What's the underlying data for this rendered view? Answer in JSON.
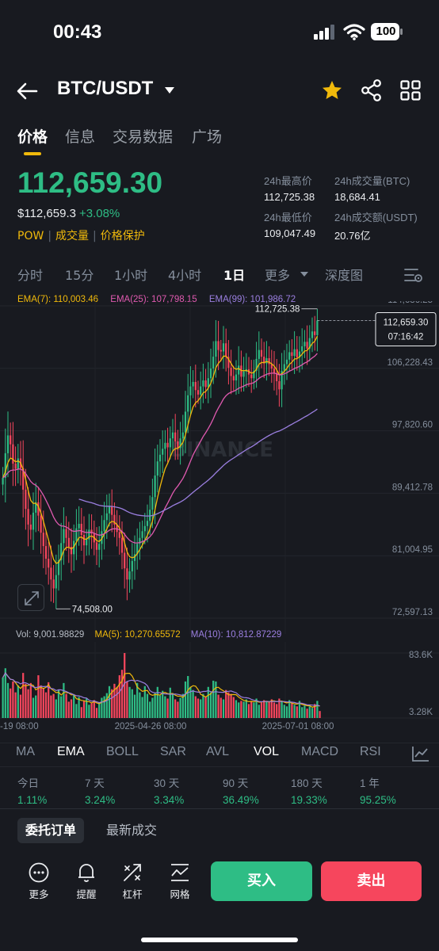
{
  "status_bar": {
    "time": "00:43",
    "battery": "100"
  },
  "header": {
    "pair": "BTC/USDT"
  },
  "main_tabs": [
    "价格",
    "信息",
    "交易数据",
    "广场"
  ],
  "price": {
    "last": "112,659.30",
    "fiat": "$112,659.3",
    "change": "+3.08%",
    "tags": [
      "POW",
      "成交量",
      "价格保护"
    ]
  },
  "stats": {
    "high_label": "24h最高价",
    "high": "112,725.38",
    "vol_btc_label": "24h成交量(BTC)",
    "vol_btc": "18,684.41",
    "low_label": "24h最低价",
    "low": "109,047.49",
    "vol_usdt_label": "24h成交额(USDT)",
    "vol_usdt": "20.76亿"
  },
  "intervals": [
    "分时",
    "15分",
    "1小时",
    "4小时",
    "1日",
    "更多",
    "深度图"
  ],
  "active_interval": "1日",
  "ema_legend": {
    "ema7": "EMA(7): 110,003.46",
    "ema25": "EMA(25): 107,798.15",
    "ema99": "EMA(99): 101,986.72"
  },
  "colors": {
    "up": "#2ebd85",
    "down": "#f6465d",
    "accent": "#f0b90b",
    "ema7": "#f0b90b",
    "ema25": "#e05ab0",
    "ema99": "#9b7fe0"
  },
  "chart_data": {
    "type": "candlestick",
    "y_ticks": [
      "114,636.25",
      "106,228.43",
      "97,820.60",
      "89,412.78",
      "81,004.95",
      "72,597.13"
    ],
    "ylim": [
      72597.13,
      114636.25
    ],
    "high_label": "112,725.38",
    "low_label": "74,508.00",
    "last_price_label": "112,659.30",
    "countdown": "07:16:42",
    "x_ticks": [
      "-19 08:00",
      "2025-04-26 08:00",
      "2025-07-01 08:00"
    ],
    "watermark": "BINANCE",
    "close": [
      91500,
      94800,
      97200,
      96000,
      93400,
      92700,
      94100,
      92800,
      89900,
      87300,
      85200,
      84500,
      86800,
      88200,
      86400,
      84100,
      82300,
      80600,
      79400,
      77800,
      76600,
      78400,
      80400,
      82700,
      84600,
      83400,
      82200,
      81200,
      83000,
      84700,
      85300,
      83800,
      82400,
      83200,
      84500,
      84000,
      82800,
      81800,
      82600,
      84300,
      85800,
      86700,
      87600,
      86500,
      85200,
      84200,
      83400,
      81400,
      79300,
      77800,
      78900,
      80300,
      81200,
      82600,
      83400,
      84300,
      85000,
      85700,
      87200,
      88900,
      91800,
      93700,
      94600,
      95400,
      96200,
      95600,
      96800,
      97600,
      96400,
      95500,
      96800,
      97600,
      100400,
      102600,
      103800,
      104400,
      103300,
      102700,
      103800,
      104600,
      103700,
      104900,
      106200,
      107800,
      109900,
      108700,
      108500,
      109600,
      107800,
      106300,
      105200,
      104600,
      105400,
      106600,
      105100,
      105800,
      106100,
      105400,
      104900,
      105900,
      107500,
      108700,
      107800,
      106900,
      107600,
      106800,
      106200,
      105600,
      104500,
      103400,
      105900,
      106800,
      107400,
      108400,
      107900,
      108800,
      107700,
      108500,
      109200,
      109800,
      108900,
      110300,
      111200,
      110700,
      112659
    ],
    "volume": {
      "y_ticks": [
        "83.6K",
        "3.28K"
      ],
      "vol": "Vol: 9,001.98829",
      "ma5": "MA(5): 10,270.65572",
      "ma10": "MA(10): 10,812.87229",
      "values": [
        52,
        64,
        45,
        38,
        47,
        33,
        42,
        30,
        58,
        44,
        37,
        45,
        26,
        29,
        55,
        42,
        38,
        33,
        46,
        29,
        31,
        24,
        36,
        28,
        45,
        31,
        21,
        24,
        30,
        18,
        27,
        14,
        22,
        25,
        17,
        19,
        23,
        13,
        20,
        26,
        28,
        32,
        41,
        37,
        44,
        40,
        55,
        62,
        83.6,
        47,
        40,
        37,
        30,
        45,
        33,
        27,
        41,
        31,
        21,
        26,
        32,
        40,
        29,
        35,
        28,
        25,
        39,
        31,
        24,
        21,
        26,
        31,
        47,
        54,
        40,
        36,
        28,
        25,
        24,
        31,
        27,
        40,
        33,
        48,
        47,
        30,
        26,
        24,
        36,
        33,
        31,
        27,
        23,
        20,
        22,
        21,
        24,
        18,
        22,
        20,
        25,
        17,
        20,
        23,
        22,
        21,
        24,
        20,
        18,
        25,
        22,
        17,
        15,
        23,
        19,
        17,
        15,
        22,
        14,
        16,
        12,
        15,
        13,
        18,
        22,
        9
      ]
    }
  },
  "indicators": [
    "MA",
    "EMA",
    "BOLL",
    "SAR",
    "AVL",
    "VOL",
    "MACD",
    "RSI"
  ],
  "performance": [
    {
      "label": "今日",
      "value": "1.11%"
    },
    {
      "label": "7 天",
      "value": "3.24%"
    },
    {
      "label": "30 天",
      "value": "3.34%"
    },
    {
      "label": "90 天",
      "value": "36.49%"
    },
    {
      "label": "180 天",
      "value": "19.33%"
    },
    {
      "label": "1 年",
      "value": "95.25%"
    }
  ],
  "order_tabs": [
    "委托订单",
    "最新成交"
  ],
  "bottom_bar": {
    "more": "更多",
    "alert": "提醒",
    "leverage": "杠杆",
    "grid": "网格",
    "buy": "买入",
    "sell": "卖出"
  }
}
